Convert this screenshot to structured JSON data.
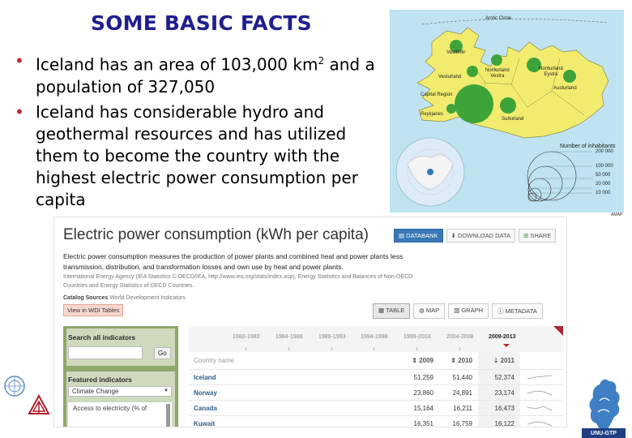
{
  "slide": {
    "title": "SOME BASIC FACTS",
    "bullet1_a": "Iceland has an area of 103,000 km",
    "bullet1_sup": "2",
    "bullet1_b": " and a population of 327,050",
    "bullet2": "Iceland has considerable hydro and geothermal resources and has utilized them to become the country with the highest electric power consumption per capita",
    "bullet_color": "#c0282d",
    "title_color": "#1f1f8f"
  },
  "map": {
    "arctic_circle": "Arctic Circle",
    "regions": {
      "vestfirdir": "Vestfirðir",
      "vesturland": "Vesturland",
      "nordurland_vestra": "Norðurland\nVestra",
      "nordurland_eystra": "Norðurland\nEystra",
      "austurland": "Austurland",
      "capital_region": "Capital Region",
      "reykjanes": "Reykjanes",
      "sudurland": "Suðurland"
    },
    "legend_title": "Number of inhabitants",
    "legend_values": [
      "200 000",
      "100 000",
      "50 000",
      "20 000",
      "10 000"
    ],
    "credit": "AMAP"
  },
  "panel": {
    "title": "Electric power consumption (kWh per capita)",
    "buttons": {
      "databank": "DATABANK",
      "download": "DOWNLOAD DATA",
      "share": "SHARE"
    },
    "description": "Electric power consumption measures the production of power plants and combined heat and power plants less transmission, distribution, and transformation losses and own use by heat and power plants.",
    "source": "International Energy Agency (IEA Statistics © OECD/IEA, http://www.iea.org/stats/index.asp), Energy Statistics and Balances of Non-OECD Countries and Energy Statistics of OECD Countries.",
    "catalog_key": "Catalog Sources",
    "catalog_value": " World Development Indicators",
    "wdi_button": "View in WDI Tables",
    "view_tabs": {
      "table": "TABLE",
      "map": "MAP",
      "graph": "GRAPH",
      "metadata": "METADATA"
    },
    "sidebar": {
      "search_label": "Search all indicators",
      "search_value": "",
      "go": "Go",
      "featured_label": "Featured indicators",
      "featured_selected": "Climate Change",
      "featured_item": "Access to electricity (% of"
    },
    "table": {
      "periods": [
        "1980-1983",
        "1984-1988",
        "1989-1993",
        "1994-1998",
        "1999-2003",
        "2004-2008",
        "2009-2013"
      ],
      "country_header": "Country name",
      "year_headers": [
        "2009",
        "2010",
        "2011"
      ],
      "rows": [
        {
          "country": "Iceland",
          "y2009": "51,259",
          "y2010": "51,440",
          "y2011": "52,374"
        },
        {
          "country": "Norway",
          "y2009": "23,860",
          "y2010": "24,891",
          "y2011": "23,174"
        },
        {
          "country": "Canada",
          "y2009": "15,164",
          "y2010": "16,211",
          "y2011": "16,473"
        },
        {
          "country": "Kuwait",
          "y2009": "16,351",
          "y2010": "16,759",
          "y2011": "16,122"
        }
      ]
    }
  },
  "logos": {
    "unu": "UNU-GTP"
  }
}
